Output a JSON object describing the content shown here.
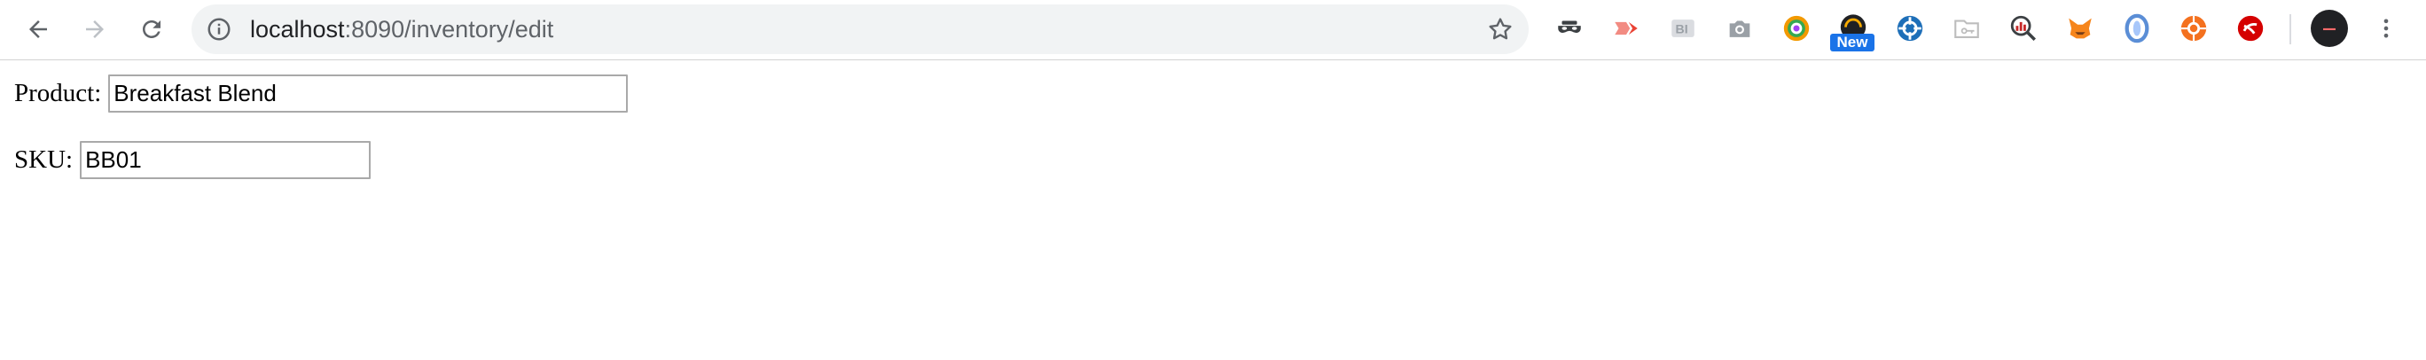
{
  "browser": {
    "url_host": "localhost",
    "url_rest": ":8090/inventory/edit",
    "extensions": [
      {
        "icon": "incognito-mask-icon",
        "color": "#3c4043"
      },
      {
        "icon": "video-play-arrow-icon",
        "color": "#f28b82"
      },
      {
        "icon": "bi-extension-icon",
        "color": "#9aa0a6"
      },
      {
        "icon": "camera-icon",
        "color": "#9aa0a6"
      },
      {
        "icon": "color-picker-eye-icon",
        "color": "#f29900"
      },
      {
        "icon": "dark-circle-extension-icon",
        "color": "#202124"
      },
      {
        "icon": "crosshair-extension-icon",
        "color": "#1e6fb8"
      },
      {
        "icon": "folder-key-icon",
        "color": "#bdbdbd"
      },
      {
        "icon": "chart-magnifier-icon",
        "color": "#c62828"
      },
      {
        "icon": "metamask-fox-icon",
        "color": "#f6851b"
      },
      {
        "icon": "blue-ring-icon",
        "color": "#5b8ed6"
      },
      {
        "icon": "orange-circle-icon",
        "color": "#f4711f"
      },
      {
        "icon": "red-circle-icon",
        "color": "#d50000"
      }
    ],
    "new_badge": "New"
  },
  "form": {
    "product_label": "Product:",
    "product_value": "Breakfast Blend",
    "sku_label": "SKU:",
    "sku_value": "BB01"
  }
}
